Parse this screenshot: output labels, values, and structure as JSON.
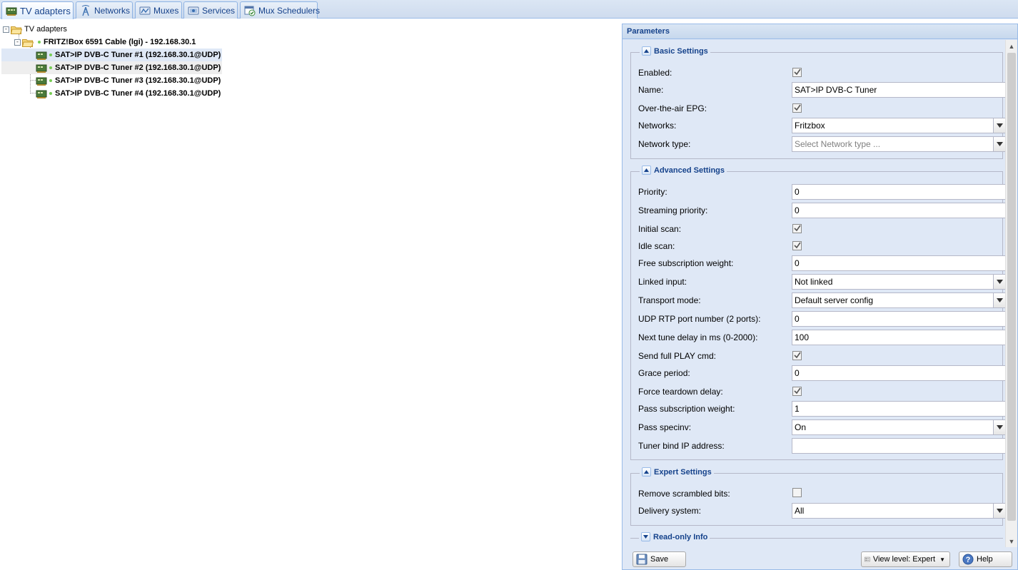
{
  "tabs": [
    {
      "label": "TV adapters",
      "icon": "tv-adapter-icon",
      "active": true
    },
    {
      "label": "Networks",
      "icon": "antenna-icon",
      "active": false
    },
    {
      "label": "Muxes",
      "icon": "muxes-icon",
      "active": false
    },
    {
      "label": "Services",
      "icon": "services-icon",
      "active": false
    },
    {
      "label": "Mux Schedulers",
      "icon": "scheduler-icon",
      "active": false
    }
  ],
  "tree": {
    "root": {
      "label": "TV adapters",
      "expander": "-"
    },
    "device": {
      "label": "FRITZ!Box 6591 Cable (lgi) - 192.168.30.1",
      "expander": "-"
    },
    "tuners": [
      {
        "label": "SAT>IP DVB-C Tuner #1 (192.168.30.1@UDP)"
      },
      {
        "label": "SAT>IP DVB-C Tuner #2 (192.168.30.1@UDP)"
      },
      {
        "label": "SAT>IP DVB-C Tuner #3 (192.168.30.1@UDP)"
      },
      {
        "label": "SAT>IP DVB-C Tuner #4 (192.168.30.1@UDP)"
      }
    ]
  },
  "params": {
    "title": "Parameters",
    "basic": {
      "title": "Basic Settings",
      "enabled_label": "Enabled:",
      "enabled": true,
      "name_label": "Name:",
      "name_value": "SAT>IP DVB-C Tuner",
      "epg_label": "Over-the-air EPG:",
      "epg": true,
      "networks_label": "Networks:",
      "networks_value": "Fritzbox",
      "network_type_label": "Network type:",
      "network_type_placeholder": "Select Network type ..."
    },
    "advanced": {
      "title": "Advanced Settings",
      "priority_label": "Priority:",
      "priority_value": "0",
      "streaming_priority_label": "Streaming priority:",
      "streaming_priority_value": "0",
      "initial_scan_label": "Initial scan:",
      "initial_scan": true,
      "idle_scan_label": "Idle scan:",
      "idle_scan": true,
      "free_sub_label": "Free subscription weight:",
      "free_sub_value": "0",
      "linked_input_label": "Linked input:",
      "linked_input_value": "Not linked",
      "transport_mode_label": "Transport mode:",
      "transport_mode_value": "Default server config",
      "udp_rtp_label": "UDP RTP port number (2 ports):",
      "udp_rtp_value": "0",
      "next_tune_label": "Next tune delay in ms (0-2000):",
      "next_tune_value": "100",
      "send_play_label": "Send full PLAY cmd:",
      "send_play": true,
      "grace_label": "Grace period:",
      "grace_value": "0",
      "force_teardown_label": "Force teardown delay:",
      "force_teardown": true,
      "pass_sub_label": "Pass subscription weight:",
      "pass_sub_value": "1",
      "pass_specinv_label": "Pass specinv:",
      "pass_specinv_value": "On",
      "tuner_bind_label": "Tuner bind IP address:",
      "tuner_bind_value": ""
    },
    "expert": {
      "title": "Expert Settings",
      "remove_scrambled_label": "Remove scrambled bits:",
      "remove_scrambled": false,
      "delivery_label": "Delivery system:",
      "delivery_value": "All"
    },
    "readonly": {
      "title": "Read-only Info"
    }
  },
  "footer": {
    "save_label": "Save",
    "view_level_label": "View level: Expert",
    "help_label": "Help"
  },
  "colors": {
    "accent_text": "#15428b",
    "panel_bg": "#dfe8f6",
    "border": "#99bbe8",
    "status_green": "#77cc55"
  }
}
